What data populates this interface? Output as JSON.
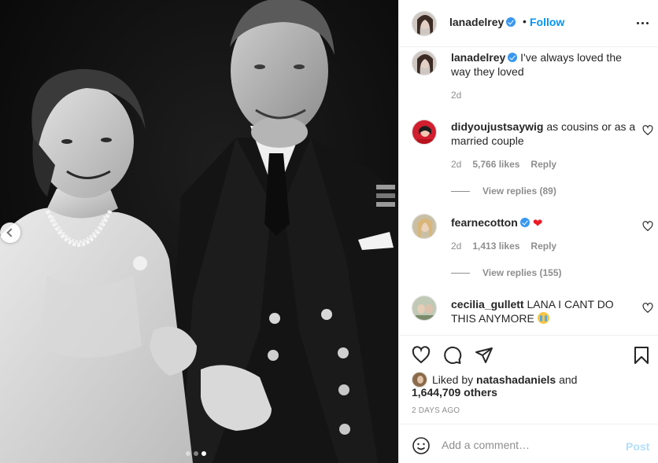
{
  "post": {
    "author": "lanadelrey",
    "follow_label": "Follow",
    "separator": "•",
    "carousel": {
      "total": 3,
      "active_index": 2
    }
  },
  "comments": [
    {
      "user": "lanadelrey",
      "text": "I've always loved the way they loved",
      "time": "2d",
      "verified": true
    },
    {
      "user": "didyoujustsaywig",
      "text": "as cousins or as a married couple",
      "time": "2d",
      "likes": "5,766 likes",
      "reply_label": "Reply",
      "view_replies": "View replies (89)"
    },
    {
      "user": "fearnecotton",
      "text": "",
      "emoji": "❤",
      "time": "2d",
      "likes": "1,413 likes",
      "reply_label": "Reply",
      "view_replies": "View replies (155)",
      "verified": true
    },
    {
      "user": "cecilia_gullett",
      "text": "LANA I CANT DO THIS ANYMORE",
      "emoji": "crying-face"
    }
  ],
  "likes": {
    "prefix": "Liked by",
    "user": "natashadaniels",
    "joiner": "and",
    "count": "1,644,709 others"
  },
  "date": "2 DAYS AGO",
  "add_comment": {
    "placeholder": "Add a comment…",
    "post_label": "Post"
  },
  "icons": {
    "like": "heart-icon",
    "comment": "comment-icon",
    "share": "send-icon",
    "save": "bookmark-icon",
    "emoji": "smiley-icon",
    "more": "more-options-icon"
  },
  "colors": {
    "link": "#0095f6",
    "verified": "#3897f0",
    "muted": "#8e8e8e",
    "post_disabled": "#b2dffc"
  }
}
